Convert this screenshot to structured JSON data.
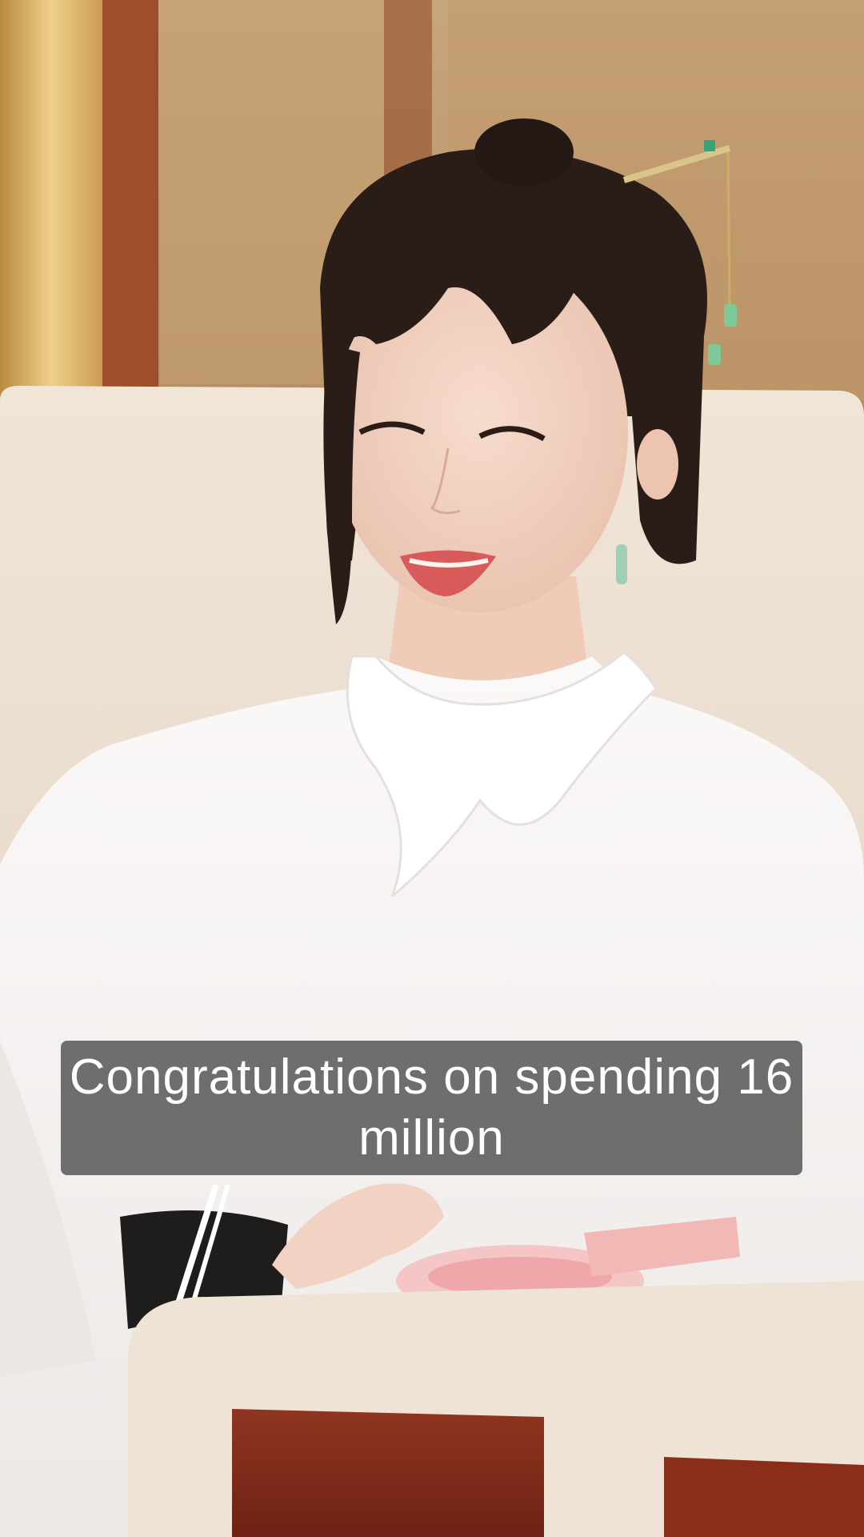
{
  "video": {
    "subtitle": "Congratulations on spending 16 million"
  },
  "colors": {
    "wall_gold": "#c99a52",
    "wood_frame": "#9c4f2a",
    "wall_panel": "#c9a77a",
    "sofa_cream": "#efe3d6",
    "blouse_white": "#f6f3f1",
    "hair_dark": "#2a1d18",
    "skin": "#f0d2c2",
    "lip_red": "#d85a5a",
    "armrest_wood": "#8a2d1a",
    "subtitle_bg": "#505050"
  }
}
